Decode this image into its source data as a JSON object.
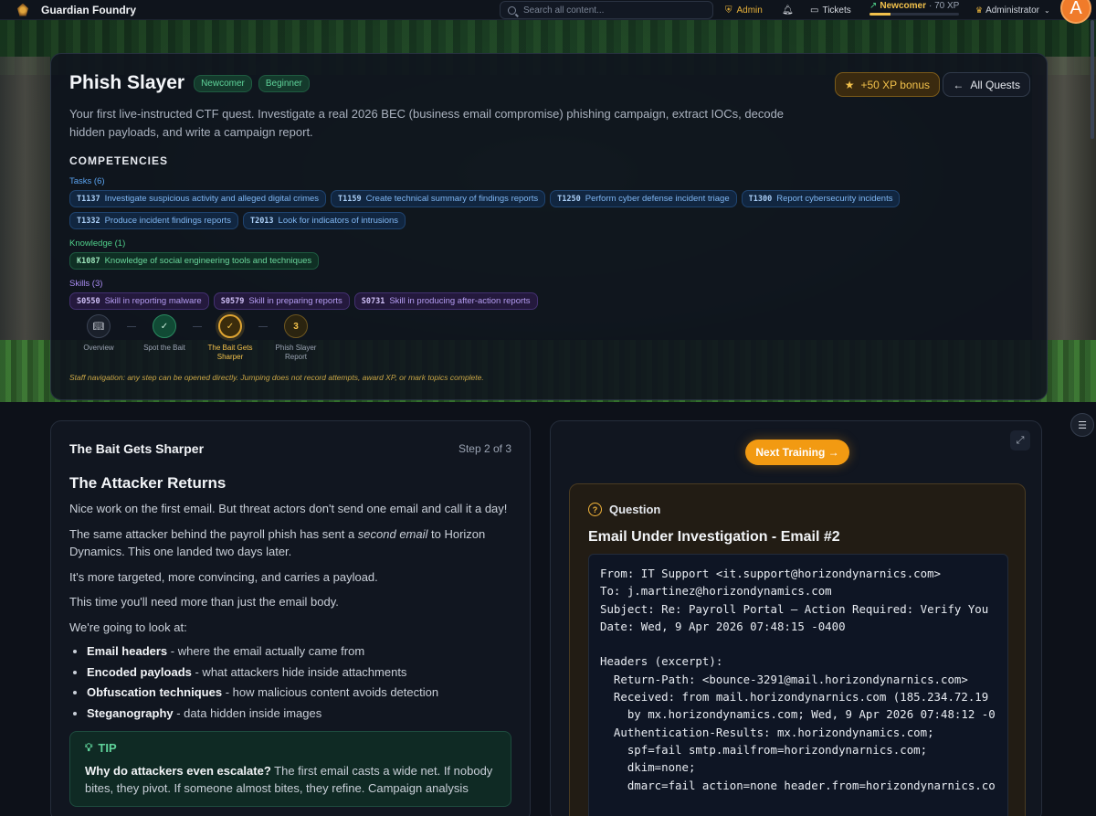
{
  "app": {
    "brand": "Guardian Foundry"
  },
  "topbar": {
    "search_placeholder": "Search all content...",
    "admin_label": "Admin",
    "tickets_label": "Tickets",
    "level_label": "Newcomer",
    "xp_label": "· 70 XP",
    "xp_progress": 0.23,
    "user_label": "Administrator",
    "avatar_letter": "A"
  },
  "quest": {
    "title": "Phish Slayer",
    "badges": [
      "Newcomer",
      "Beginner"
    ],
    "xp_bonus": "+50 XP bonus",
    "all_quests": "All Quests",
    "description": "Your first live-instructed CTF quest. Investigate a real 2026 BEC (business email compromise) phishing campaign, extract IOCs, decode hidden payloads, and write a campaign report.",
    "competencies_title": "COMPETENCIES",
    "tasks_label": "Tasks (6)",
    "tasks": [
      {
        "code": "T1137",
        "text": "Investigate suspicious activity and alleged digital crimes"
      },
      {
        "code": "T1159",
        "text": "Create technical summary of findings reports"
      },
      {
        "code": "T1250",
        "text": "Perform cyber defense incident triage"
      },
      {
        "code": "T1300",
        "text": "Report cybersecurity incidents"
      },
      {
        "code": "T1332",
        "text": "Produce incident findings reports"
      },
      {
        "code": "T2013",
        "text": "Look for indicators of intrusions"
      }
    ],
    "knowledge_label": "Knowledge (1)",
    "knowledge": [
      {
        "code": "K1087",
        "text": "Knowledge of social engineering tools and techniques"
      }
    ],
    "skills_label": "Skills (3)",
    "skills": [
      {
        "code": "S0550",
        "text": "Skill in reporting malware"
      },
      {
        "code": "S0579",
        "text": "Skill in preparing reports"
      },
      {
        "code": "S0731",
        "text": "Skill in producing after-action reports"
      }
    ],
    "steps": [
      {
        "label": "Overview",
        "state": "overview",
        "mark": ""
      },
      {
        "label": "Spot the Bait",
        "state": "done",
        "mark": "✓"
      },
      {
        "label": "The Bait Gets Sharper",
        "state": "current",
        "mark": "✓"
      },
      {
        "label": "Phish Slayer Report",
        "state": "todo",
        "mark": "3"
      }
    ],
    "staff_note": "Staff navigation: any step can be opened directly. Jumping does not record attempts, award XP, or mark topics complete."
  },
  "lesson": {
    "title": "The Bait Gets Sharper",
    "step": "Step 2 of 3",
    "heading": "The Attacker Returns",
    "p1": "Nice work on the first email. But threat actors don't send one email and call it a day!",
    "p2_before": "The same attacker behind the payroll phish has sent a ",
    "p2_em": "second email",
    "p2_after": " to Horizon Dynamics. This one landed two days later.",
    "p3": "It's more targeted, more convincing, and carries a payload.",
    "p4": "This time you'll need more than just the email body.",
    "p5": "We're going to look at:",
    "bullets": [
      {
        "bold": "Email headers",
        "rest": " - where the email actually came from"
      },
      {
        "bold": "Encoded payloads",
        "rest": " - what attackers hide inside attachments"
      },
      {
        "bold": "Obfuscation techniques",
        "rest": " - how malicious content avoids detection"
      },
      {
        "bold": "Steganography",
        "rest": " - data hidden inside images"
      }
    ],
    "tip_title": "TIP",
    "tip_bold": "Why do attackers even escalate?",
    "tip_rest": " The first email casts a wide net. If nobody bites, they pivot. If someone almost bites, they refine. Campaign analysis"
  },
  "panel": {
    "next_button": "Next Training →",
    "question_label": "Question",
    "question_title": "Email Under Investigation - Email #2",
    "email_body": "From: IT Support <it.support@horizondynarnics.com>\nTo: j.martinez@horizondynamics.com\nSubject: Re: Payroll Portal – Action Required: Verify You\nDate: Wed, 9 Apr 2026 07:48:15 -0400\n\nHeaders (excerpt):\n  Return-Path: <bounce-3291@mail.horizondynarnics.com>\n  Received: from mail.horizondynarnics.com (185.234.72.19\n    by mx.horizondynamics.com; Wed, 9 Apr 2026 07:48:12 -0\n  Authentication-Results: mx.horizondynamics.com;\n    spf=fail smtp.mailfrom=horizondynarnics.com;\n    dkim=none;\n    dmarc=fail action=none header.from=horizondynarnics.co"
  }
}
